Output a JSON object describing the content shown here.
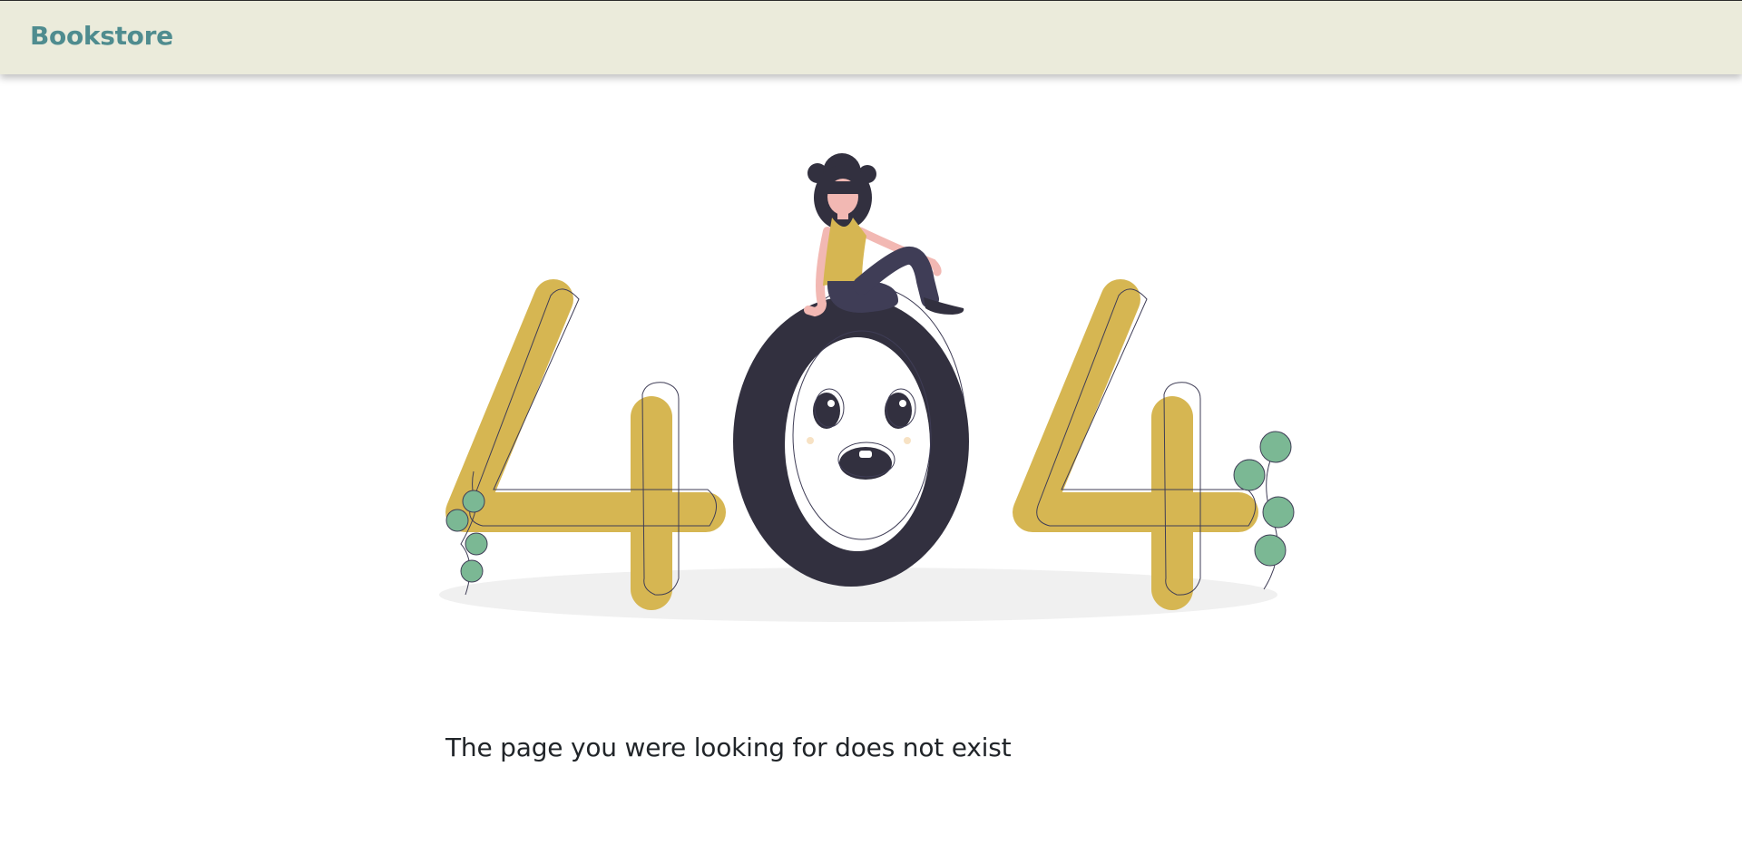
{
  "navbar": {
    "brand": "Bookstore"
  },
  "illustration": {
    "icon": "404-illustration",
    "colors": {
      "accent": "#d6b652",
      "dark": "#32303f",
      "leaf": "#7bb894",
      "skin": "#f2b8b3",
      "shadow": "#f0f0f0"
    }
  },
  "main": {
    "message": "The page you were looking for does not exist"
  },
  "colors": {
    "navbar_bg": "#ebebdb",
    "brand": "#4f8c8f",
    "text": "#212529"
  }
}
